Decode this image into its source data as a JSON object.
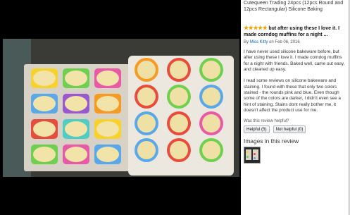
{
  "product": {
    "title": "Cutequeen Trading 24pcs (12pcs Round and 12pcs Rectangular) Silicone Baking"
  },
  "review": {
    "stars": "★★★★★",
    "headline": "but after using these I love it. I made corndog muffins for a night ...",
    "by_prefix": "By",
    "author": "Miss Kitty",
    "date": "on Feb 06, 2016",
    "paragraph_1": "I have never used silicone bakeware before, but after using these I love it. I made corndog muffins for a night with friends. Baked well, came out easy, and cleaned up easy.",
    "paragraph_2": "I read some reviews on silicone bakeware and staining. I found with these that only two colors stained - the rounds pink and blue. Even though some of the colors are darker, I didn't even see a hint of staining. Stains dont really bother me, it doesn't affect the product use for me."
  },
  "helpful": {
    "question": "Was this review helpful?",
    "yes_label": "Helpful (5)",
    "no_label": "Not helpful (0)"
  },
  "images": {
    "heading": "Images in this review"
  },
  "colors": {
    "star": "#f0a30a",
    "link": "#0066c0"
  },
  "photo": {
    "tray_left_rect_colors": [
      "#f7d22d",
      "#6fcf4e",
      "#e85aa6",
      "#5aa8e8",
      "#9b59d0",
      "#f59a23",
      "#e74c3c",
      "#4ecdc4",
      "#f7d22d",
      "#6fcf4e",
      "#e85aa6",
      "#5aa8e8"
    ],
    "tray_right_round_colors": [
      "#f59a23",
      "#e74c3c",
      "#6fcf4e",
      "#e74c3c",
      "#6fcf4e",
      "#5aa8e8",
      "#5aa8e8",
      "#e74c3c",
      "#e85aa6",
      "#5aa8e8",
      "#e74c3c",
      "#6fcf4e"
    ]
  }
}
